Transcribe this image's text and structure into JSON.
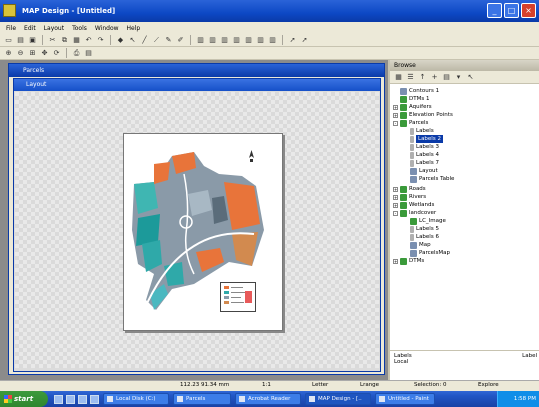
{
  "app": {
    "title": "MAP Design - [Untitled]",
    "menus": [
      "File",
      "Edit",
      "Layout",
      "Tools",
      "Window",
      "Help"
    ]
  },
  "windows": {
    "outer_title": "Parcels",
    "inner_title": "Layout"
  },
  "panel": {
    "title": "Browse",
    "tree": [
      {
        "label": "Contours 1",
        "icon": "layer",
        "level": 1
      },
      {
        "label": "DTMs 1",
        "icon": "green",
        "level": 1
      },
      {
        "label": "Aquifers",
        "icon": "green",
        "level": 1,
        "expand": "+"
      },
      {
        "label": "Elevation Points",
        "icon": "green",
        "level": 1,
        "expand": "+"
      },
      {
        "label": "Parcels",
        "icon": "green",
        "level": 1,
        "expand": "-"
      },
      {
        "label": "Labels",
        "icon": "label",
        "level": 2
      },
      {
        "label": "Labels 2",
        "icon": "label",
        "level": 2,
        "selected": true
      },
      {
        "label": "Labels 3",
        "icon": "label",
        "level": 2
      },
      {
        "label": "Labels 4",
        "icon": "label",
        "level": 2
      },
      {
        "label": "Labels 7",
        "icon": "label",
        "level": 2
      },
      {
        "label": "Layout",
        "icon": "layer",
        "level": 2
      },
      {
        "label": "Parcels Table",
        "icon": "layer",
        "level": 2
      },
      {
        "label": "Roads",
        "icon": "green",
        "level": 1,
        "expand": "+"
      },
      {
        "label": "Rivers",
        "icon": "green",
        "level": 1,
        "expand": "+"
      },
      {
        "label": "Wetlands",
        "icon": "green",
        "level": 1,
        "expand": "+"
      },
      {
        "label": "landcover",
        "icon": "green",
        "level": 1,
        "expand": "-"
      },
      {
        "label": "LC_Image",
        "icon": "green",
        "level": 2
      },
      {
        "label": "Labels 5",
        "icon": "label",
        "level": 2
      },
      {
        "label": "Labels 6",
        "icon": "label",
        "level": 2
      },
      {
        "label": "Map",
        "icon": "layer",
        "level": 2
      },
      {
        "label": "ParcelsMap",
        "icon": "layer",
        "level": 2
      },
      {
        "label": "DTMs",
        "icon": "green",
        "level": 1,
        "expand": "+"
      }
    ],
    "bottom_line1": "Labels",
    "bottom_line2": "Local",
    "bottom_right": "Label"
  },
  "status": {
    "coords": "112.23 91.34 mm",
    "zoom": "1:1",
    "field3": "Letter",
    "field4": "Lrange",
    "selection": "Selection: 0",
    "mode": "Explore"
  },
  "taskbar": {
    "start": "start",
    "tasks": [
      "Local Disk (C:)",
      "Parcels",
      "Acrobat Reader",
      "MAP Design - [..",
      "Untitled - Paint"
    ],
    "clock": "1:58 PM"
  },
  "colors": {
    "title_blue": "#0d48c5",
    "selection": "#0a3aa8"
  }
}
